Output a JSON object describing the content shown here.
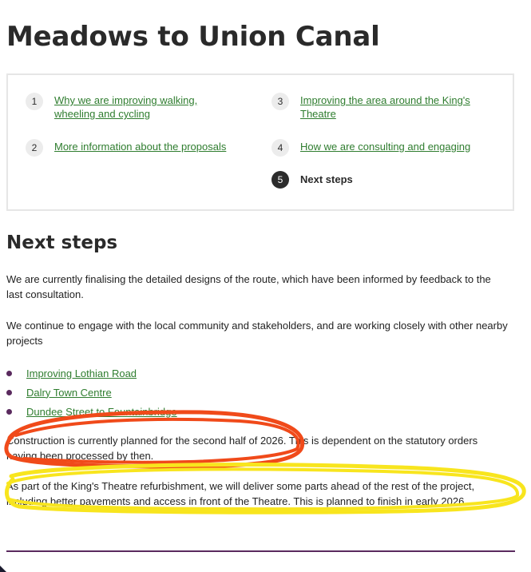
{
  "page_title": "Meadows to Union Canal",
  "toc": {
    "items": [
      {
        "number": "1",
        "label": "Why we are improving walking, wheeling and cycling"
      },
      {
        "number": "2",
        "label": "More information about the proposals"
      },
      {
        "number": "3",
        "label": "Improving the area around the King's Theatre"
      },
      {
        "number": "4",
        "label": "How we are consulting and engaging"
      },
      {
        "number": "5",
        "label": "Next steps"
      }
    ]
  },
  "section": {
    "heading": "Next steps",
    "paragraph_1": "We are currently finalising the detailed designs of the route, which have been informed by feedback to the last consultation.",
    "paragraph_2": "We continue to engage with the local community and stakeholders, and are working closely with other nearby projects",
    "links": [
      "Improving Lothian Road",
      "Dalry Town Centre",
      "Dundee Street to Fountainbridge"
    ],
    "paragraph_3": "Construction is currently planned for the second half of 2026. This is dependent on the statutory orders having been processed by then.",
    "paragraph_4": "As part of the King's Theatre refurbishment, we will deliver some parts ahead of the rest of the project, including better pavements and access in front of the Theatre. This is planned to finish in early 2026."
  },
  "colors": {
    "link": "#2f7d2f",
    "accent_purple": "#5a2a5e",
    "annotation_red": "#f04a1a",
    "annotation_yellow": "#f8e51e"
  }
}
